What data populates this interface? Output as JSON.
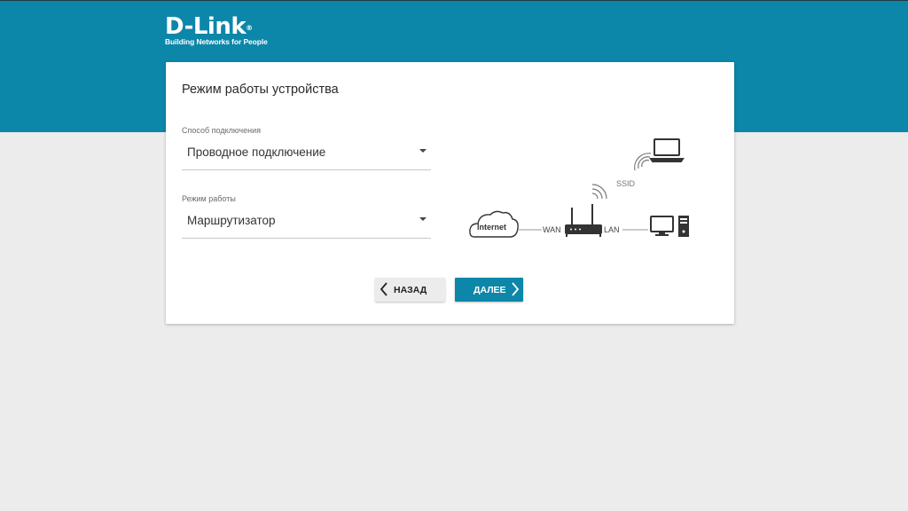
{
  "header": {
    "logo": {
      "brand": "D-Link",
      "registered": "®",
      "tagline": "Building Networks for People"
    }
  },
  "card": {
    "title": "Режим работы устройства",
    "connection_method": {
      "label": "Способ подключения",
      "value": "Проводное подключение"
    },
    "work_mode": {
      "label": "Режим работы",
      "value": "Маршрутизатор"
    },
    "buttons": {
      "back": "НАЗАД",
      "next": "ДАЛЕЕ"
    },
    "diagram": {
      "internet": "Internet",
      "wan": "WAN",
      "lan": "LAN",
      "ssid": "SSID"
    }
  },
  "colors": {
    "accent": "#0c87a9",
    "background": "#ececec",
    "card": "#ffffff"
  }
}
